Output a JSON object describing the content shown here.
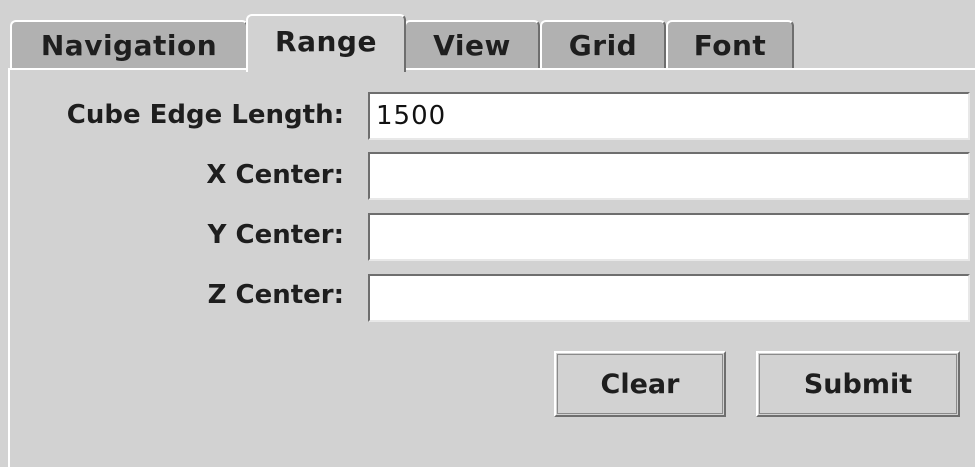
{
  "tabs": [
    {
      "label": "Navigation",
      "active": false
    },
    {
      "label": "Range",
      "active": true
    },
    {
      "label": "View",
      "active": false
    },
    {
      "label": "Grid",
      "active": false
    },
    {
      "label": "Font",
      "active": false
    }
  ],
  "form": {
    "cube_edge_length": {
      "label": "Cube Edge Length:",
      "value": "1500"
    },
    "x_center": {
      "label": "X Center:",
      "value": ""
    },
    "y_center": {
      "label": "Y Center:",
      "value": ""
    },
    "z_center": {
      "label": "Z Center:",
      "value": ""
    }
  },
  "buttons": {
    "clear_label": "Clear",
    "submit_label": "Submit"
  },
  "colors": {
    "background": "#d2d2d2",
    "inactive_tab": "#b1b1b1",
    "field_background": "#ffffff",
    "text": "#1e1e1e"
  }
}
